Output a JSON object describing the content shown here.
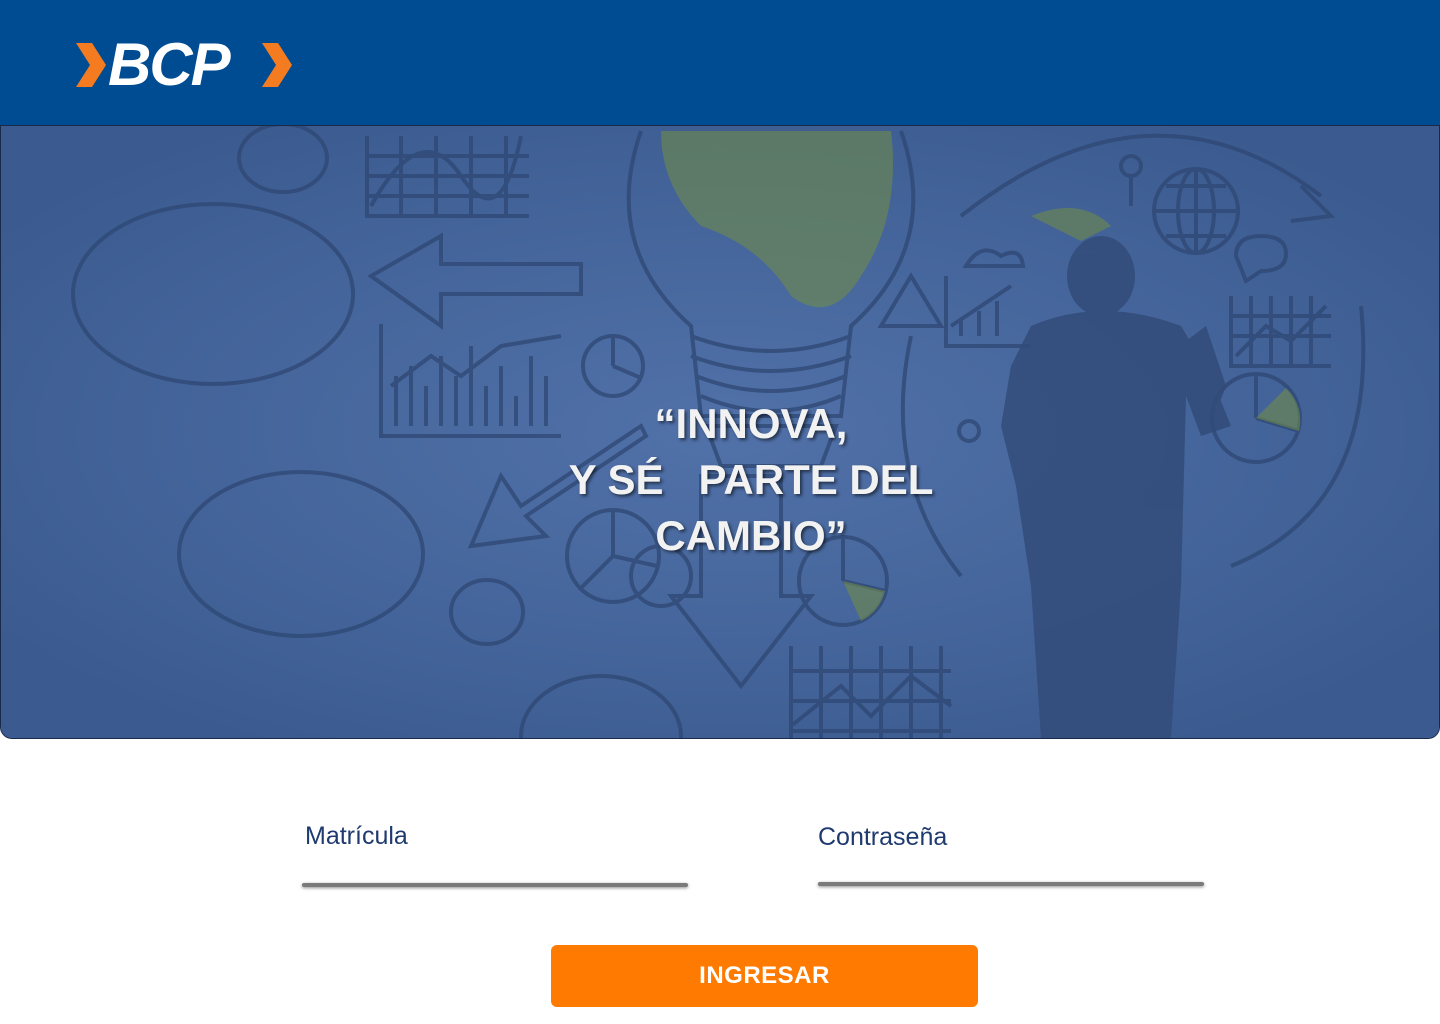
{
  "header": {
    "logo_text": "BCP",
    "background_color": "#004C93",
    "logo_accent_color": "#F47B20"
  },
  "hero": {
    "quote_line1": "“INNOVA,",
    "quote_line2": "Y SÉ   PARTE DEL",
    "quote_line3": "CAMBIO”"
  },
  "form": {
    "username_label": "Matrícula",
    "password_label": "Contraseña",
    "username_value": "",
    "password_value": "",
    "submit_label": "INGRESAR",
    "submit_color": "#FF7A00"
  }
}
